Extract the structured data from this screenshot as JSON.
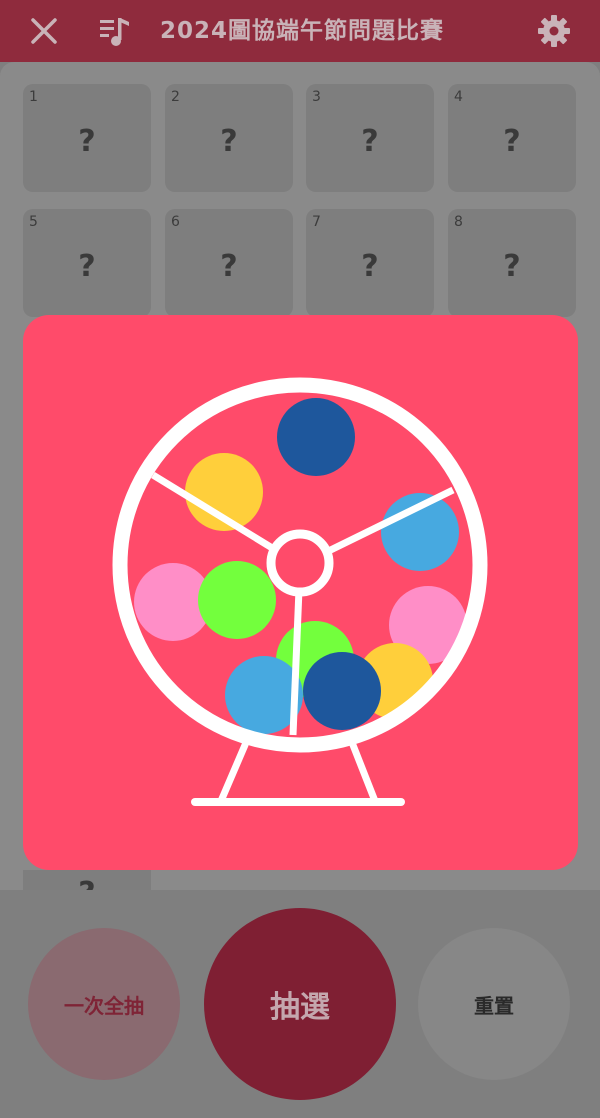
{
  "header": {
    "title": "2024圖協端午節問題比賽",
    "icons": [
      "close-icon",
      "playlist-music-icon",
      "gear-icon"
    ]
  },
  "cards": [
    {
      "num": "1",
      "q": "?"
    },
    {
      "num": "2",
      "q": "?"
    },
    {
      "num": "3",
      "q": "?"
    },
    {
      "num": "4",
      "q": "?"
    },
    {
      "num": "5",
      "q": "?"
    },
    {
      "num": "6",
      "q": "?"
    },
    {
      "num": "7",
      "q": "?"
    },
    {
      "num": "8",
      "q": "?"
    }
  ],
  "peek_card": {
    "q": "?"
  },
  "colors": {
    "overlay": "#ff4b6a",
    "header": "#8f2b3d",
    "draw_button": "#7f1f33"
  },
  "actions": {
    "draw_all": "一次全抽",
    "draw": "抽選",
    "reset": "重置"
  }
}
